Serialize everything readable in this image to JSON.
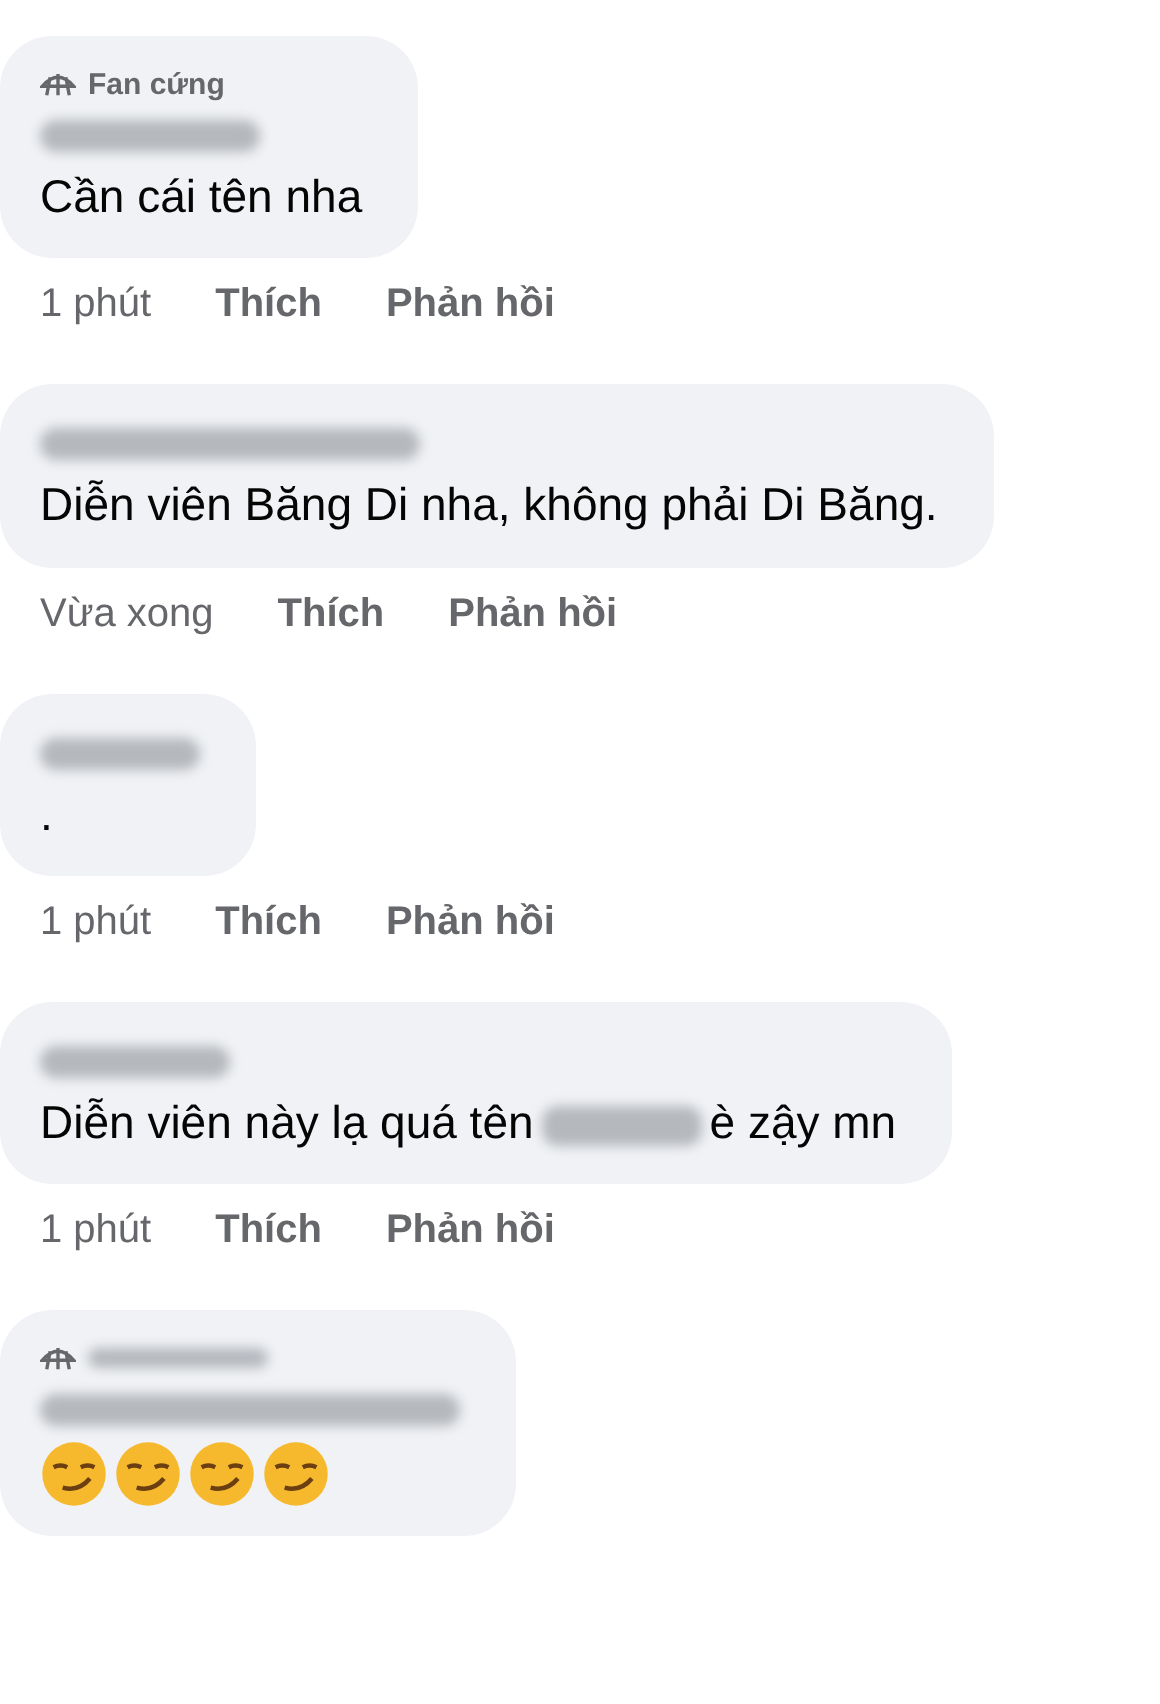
{
  "comments": [
    {
      "badge": {
        "kind": "fan",
        "label": "Fan cứng"
      },
      "content": [
        {
          "kind": "text",
          "text": "Cần cái tên nha"
        }
      ],
      "time": "1 phút",
      "like": "Thích",
      "reply": "Phản hồi"
    },
    {
      "content": [
        {
          "kind": "text",
          "text": "Diễn viên Băng Di nha, không phải Di Băng."
        }
      ],
      "time": "Vừa xong",
      "like": "Thích",
      "reply": "Phản hồi"
    },
    {
      "content": [
        {
          "kind": "text",
          "text": "."
        }
      ],
      "time": "1 phút",
      "like": "Thích",
      "reply": "Phản hồi"
    },
    {
      "content": [
        {
          "kind": "text",
          "text": "Diễn viên này lạ quá tên"
        },
        {
          "kind": "redacted"
        },
        {
          "kind": "text",
          "text": "è zậy mn"
        }
      ],
      "time": "1 phút",
      "like": "Thích",
      "reply": "Phản hồi"
    },
    {
      "badge": {
        "kind": "fan"
      },
      "content": [
        {
          "kind": "emoji"
        },
        {
          "kind": "emoji"
        },
        {
          "kind": "emoji"
        },
        {
          "kind": "emoji"
        }
      ]
    }
  ]
}
